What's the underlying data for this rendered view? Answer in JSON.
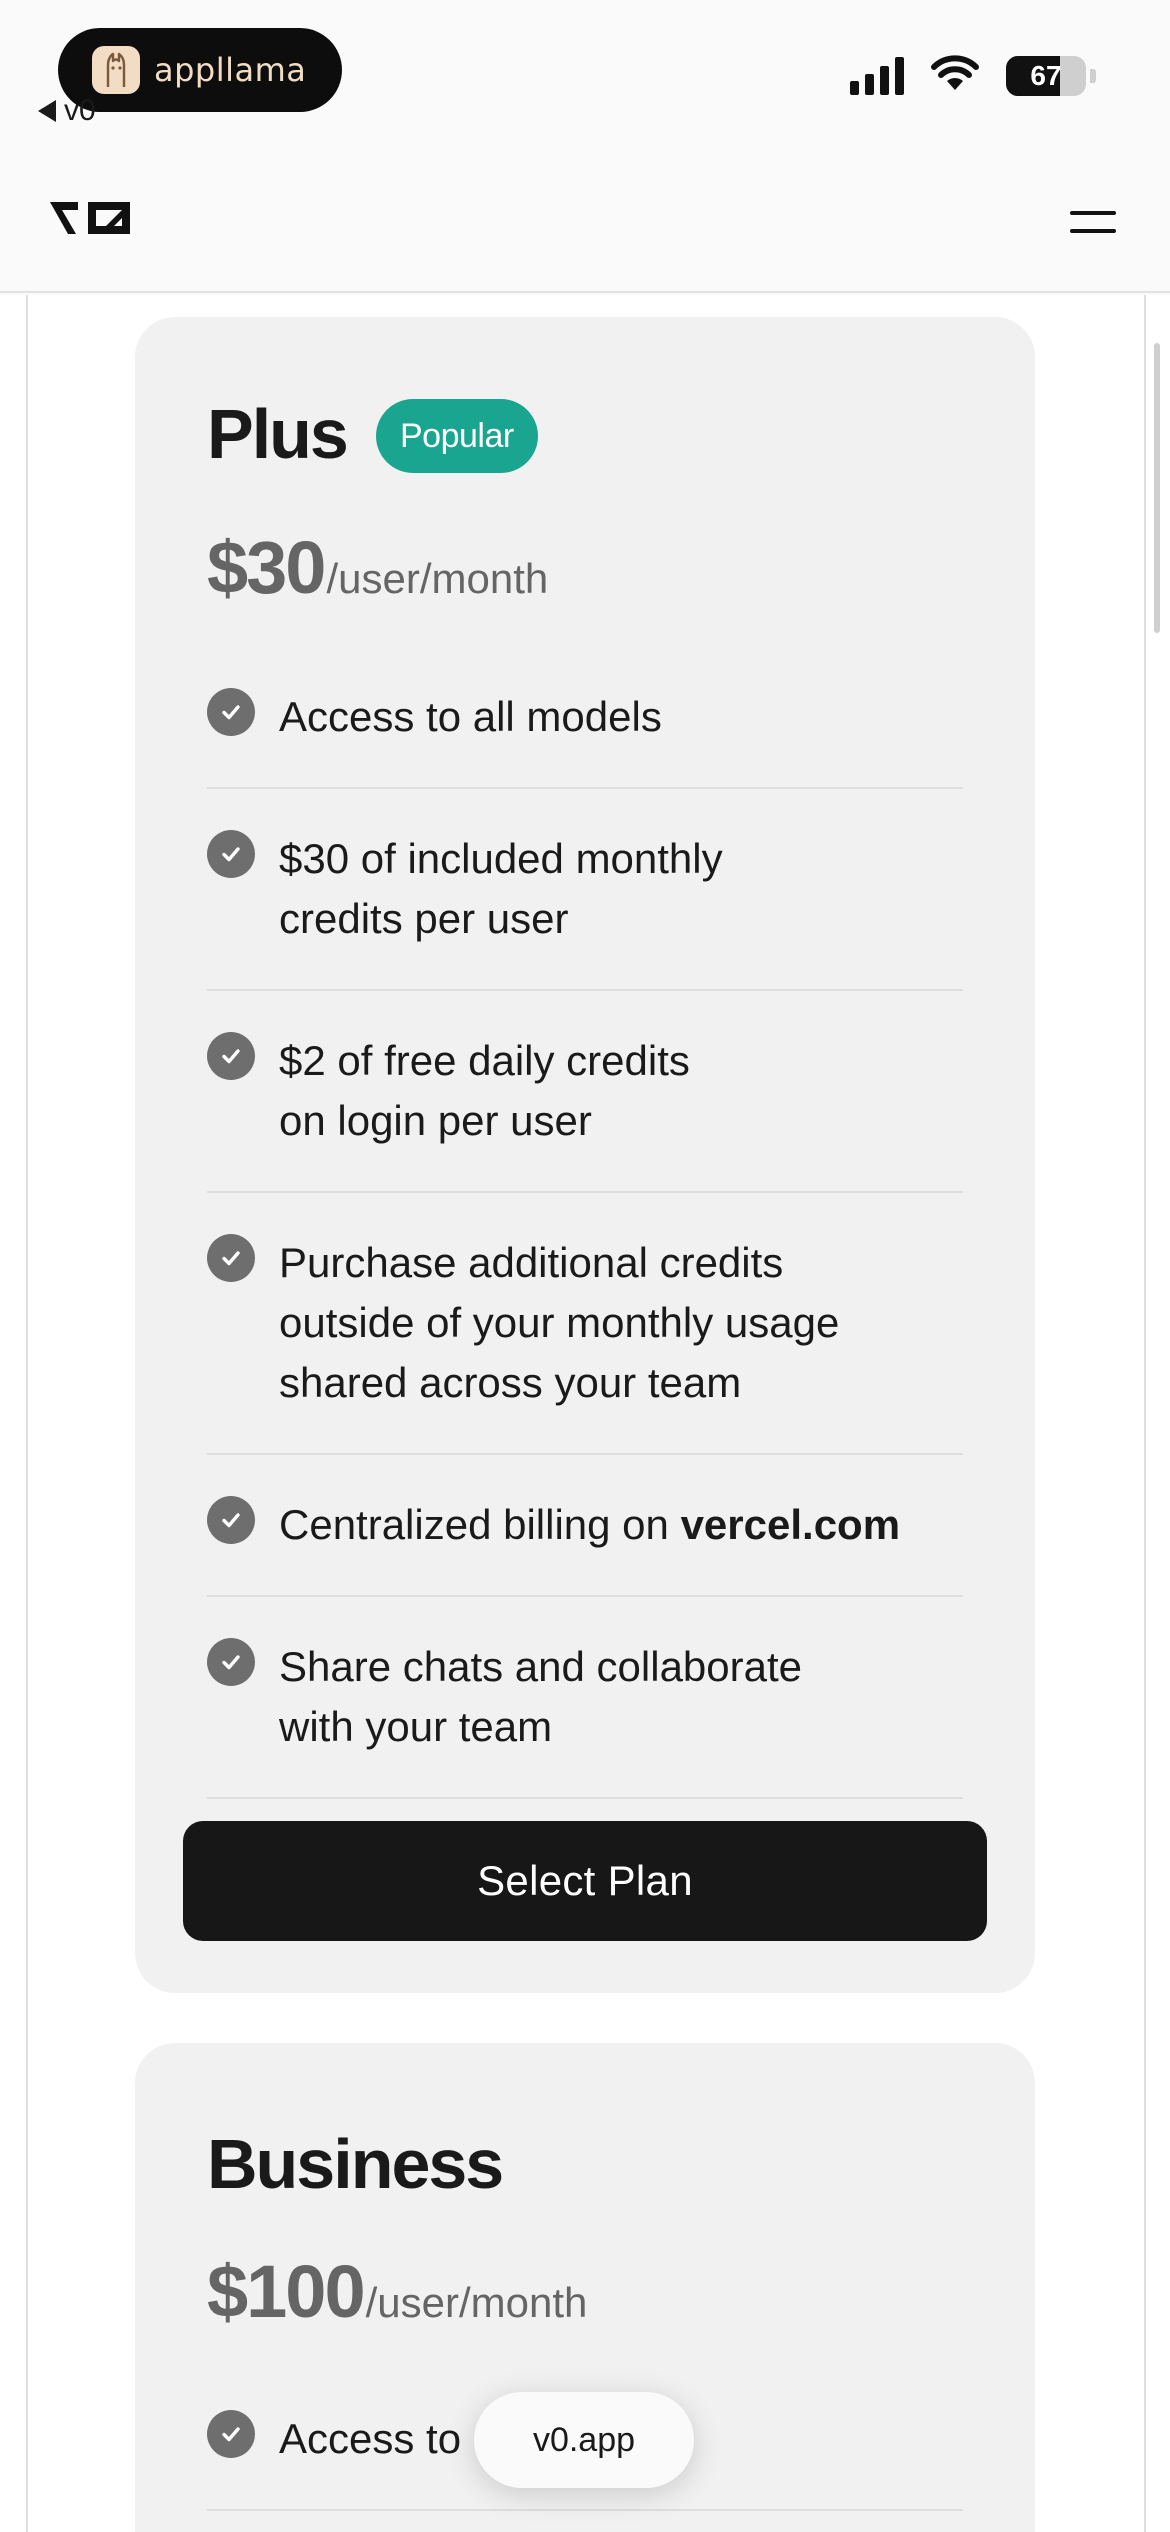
{
  "status_bar": {
    "badge_app_name": "appllama",
    "back_label": "v0",
    "battery_level": "67",
    "battery_fraction": 0.67
  },
  "nav": {
    "logo_icon": "v0-logo-icon",
    "menu_icon": "hamburger-menu-icon"
  },
  "plans": [
    {
      "name": "Plus",
      "badge": "Popular",
      "price": "$30",
      "price_unit": "/user/month",
      "features": [
        "Access to all models",
        "$30 of included monthly credits per user",
        "$2 of free daily credits on login per user",
        "Purchase additional credits outside of your monthly usage shared across your team",
        "Centralized billing on ",
        "Share chats and collaborate with your team"
      ],
      "billing_link": "vercel.com",
      "cta": "Select Plan"
    },
    {
      "name": "Business",
      "price": "$100",
      "price_unit": "/user/month",
      "features": [
        "Access to"
      ]
    }
  ],
  "floating_pill": "v0.app",
  "colors": {
    "accent_badge": "#19a58f",
    "card_bg": "#f1f1f1",
    "button_bg": "#171717",
    "check_icon": "#6e6e6e"
  }
}
